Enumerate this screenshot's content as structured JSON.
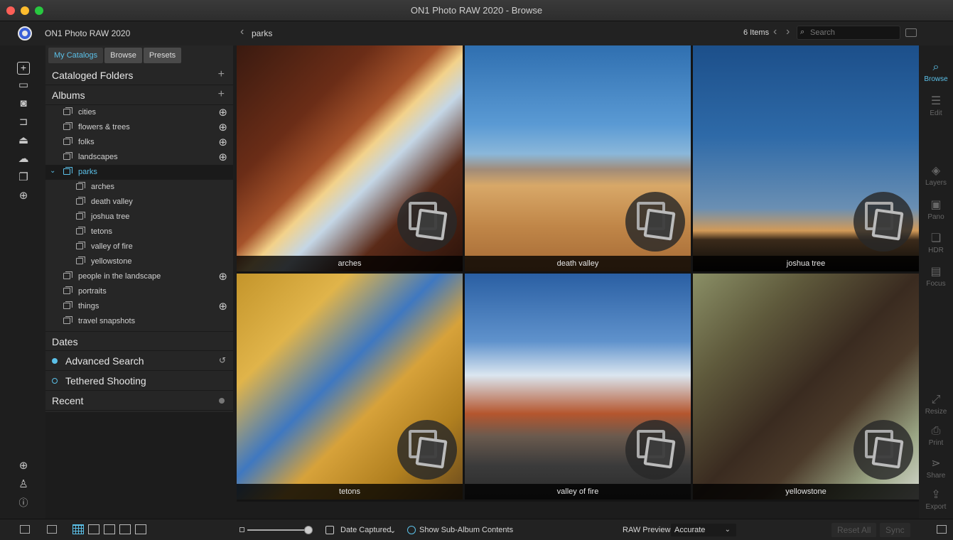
{
  "window": {
    "title": "ON1 Photo RAW 2020 - Browse"
  },
  "header": {
    "app_name": "ON1 Photo RAW 2020",
    "breadcrumb": "parks",
    "item_count": "6 Items",
    "search_placeholder": "Search"
  },
  "sidebar": {
    "tabs": [
      {
        "label": "My Catalogs"
      },
      {
        "label": "Browse"
      },
      {
        "label": "Presets"
      }
    ],
    "sections": {
      "cataloged_folders": "Cataloged Folders",
      "albums": "Albums",
      "dates": "Dates",
      "advanced_search": "Advanced Search",
      "tethered_shooting": "Tethered Shooting",
      "recent": "Recent"
    },
    "albums": [
      {
        "label": "cities",
        "shared": true
      },
      {
        "label": "flowers & trees",
        "shared": true
      },
      {
        "label": "folks",
        "shared": true
      },
      {
        "label": "landscapes",
        "shared": true
      },
      {
        "label": "parks",
        "selected": true,
        "expanded": true
      },
      {
        "label": "arches",
        "child": true
      },
      {
        "label": "death valley",
        "child": true
      },
      {
        "label": "joshua tree",
        "child": true
      },
      {
        "label": "tetons",
        "child": true
      },
      {
        "label": "valley of fire",
        "child": true
      },
      {
        "label": "yellowstone",
        "child": true
      },
      {
        "label": "people in the landscape",
        "shared": true
      },
      {
        "label": "portraits"
      },
      {
        "label": "things",
        "shared": true
      },
      {
        "label": "travel snapshots"
      }
    ]
  },
  "grid": {
    "items": [
      {
        "caption": "arches",
        "bg": "linear-gradient(135deg,#3a1a10 0%,#6b2d17 30%,#a5522a 45%,#f3d28a 52%,#c4d6e6 60%,#5a2a18 75%,#2a120a 100%)"
      },
      {
        "caption": "death valley",
        "bg": "linear-gradient(180deg,#2f6fb0 0%,#5a9ad4 35%,#8ab7da 48%,#a28c78 55%,#d8a868 62%,#c08648 80%,#a56a35 100%)"
      },
      {
        "caption": "joshua tree",
        "bg": "linear-gradient(180deg,#1c4f8a 0%,#2e6aa8 40%,#6a8fb3 72%,#d29a58 82%,#3a2a1a 86%,#0c0a08 100%)"
      },
      {
        "caption": "tetons",
        "bg": "linear-gradient(135deg,#c4952b 0%,#e0b44a 25%,#3f78c0 45%,#d7a23a 60%,#b07f1f 80%,#6a4a1e 100%)"
      },
      {
        "caption": "valley of fire",
        "bg": "linear-gradient(180deg,#2a5fa3 0%,#5f92cc 30%,#dbe6f0 45%,#b5562e 62%,#6a5a4e 72%,#3b3b3b 85%,#2a2a2a 100%)"
      },
      {
        "caption": "yellowstone",
        "bg": "linear-gradient(135deg,#8a8f66 0%,#5f5a3c 25%,#3a2b20 50%,#4b3a2a 65%,#9aa584 85%,#d5d8cf 100%)"
      }
    ]
  },
  "right_tools": [
    {
      "label": "Browse",
      "icon": "browse-icon",
      "active": true
    },
    {
      "label": "Edit",
      "icon": "edit-icon"
    },
    {
      "label": "Layers",
      "icon": "layers-icon"
    },
    {
      "label": "Pano",
      "icon": "pano-icon"
    },
    {
      "label": "HDR",
      "icon": "hdr-icon"
    },
    {
      "label": "Focus",
      "icon": "focus-icon"
    },
    {
      "label": "Resize",
      "icon": "resize-icon"
    },
    {
      "label": "Print",
      "icon": "print-icon"
    },
    {
      "label": "Share",
      "icon": "share-icon"
    },
    {
      "label": "Export",
      "icon": "export-icon"
    }
  ],
  "bottom": {
    "sort_label": "Date Captured",
    "show_sub_album": "Show Sub-Album Contents",
    "raw_previews_label": "RAW Previews",
    "raw_previews_value": "Accurate",
    "reset_all": "Reset All",
    "sync": "Sync"
  },
  "colors": {
    "accent": "#5bc0e8"
  }
}
